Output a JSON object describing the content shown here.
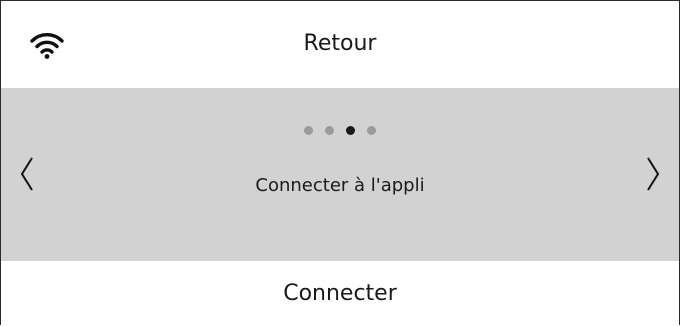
{
  "header": {
    "status_icon": "wifi-icon",
    "back_label": "Retour"
  },
  "carousel": {
    "total_pages": 4,
    "current_page": 3,
    "slide_label": "Connecter à l'appli",
    "prev_icon": "chevron-left-icon",
    "next_icon": "chevron-right-icon",
    "background": "#d2d2d2"
  },
  "footer": {
    "connect_label": "Connecter"
  }
}
